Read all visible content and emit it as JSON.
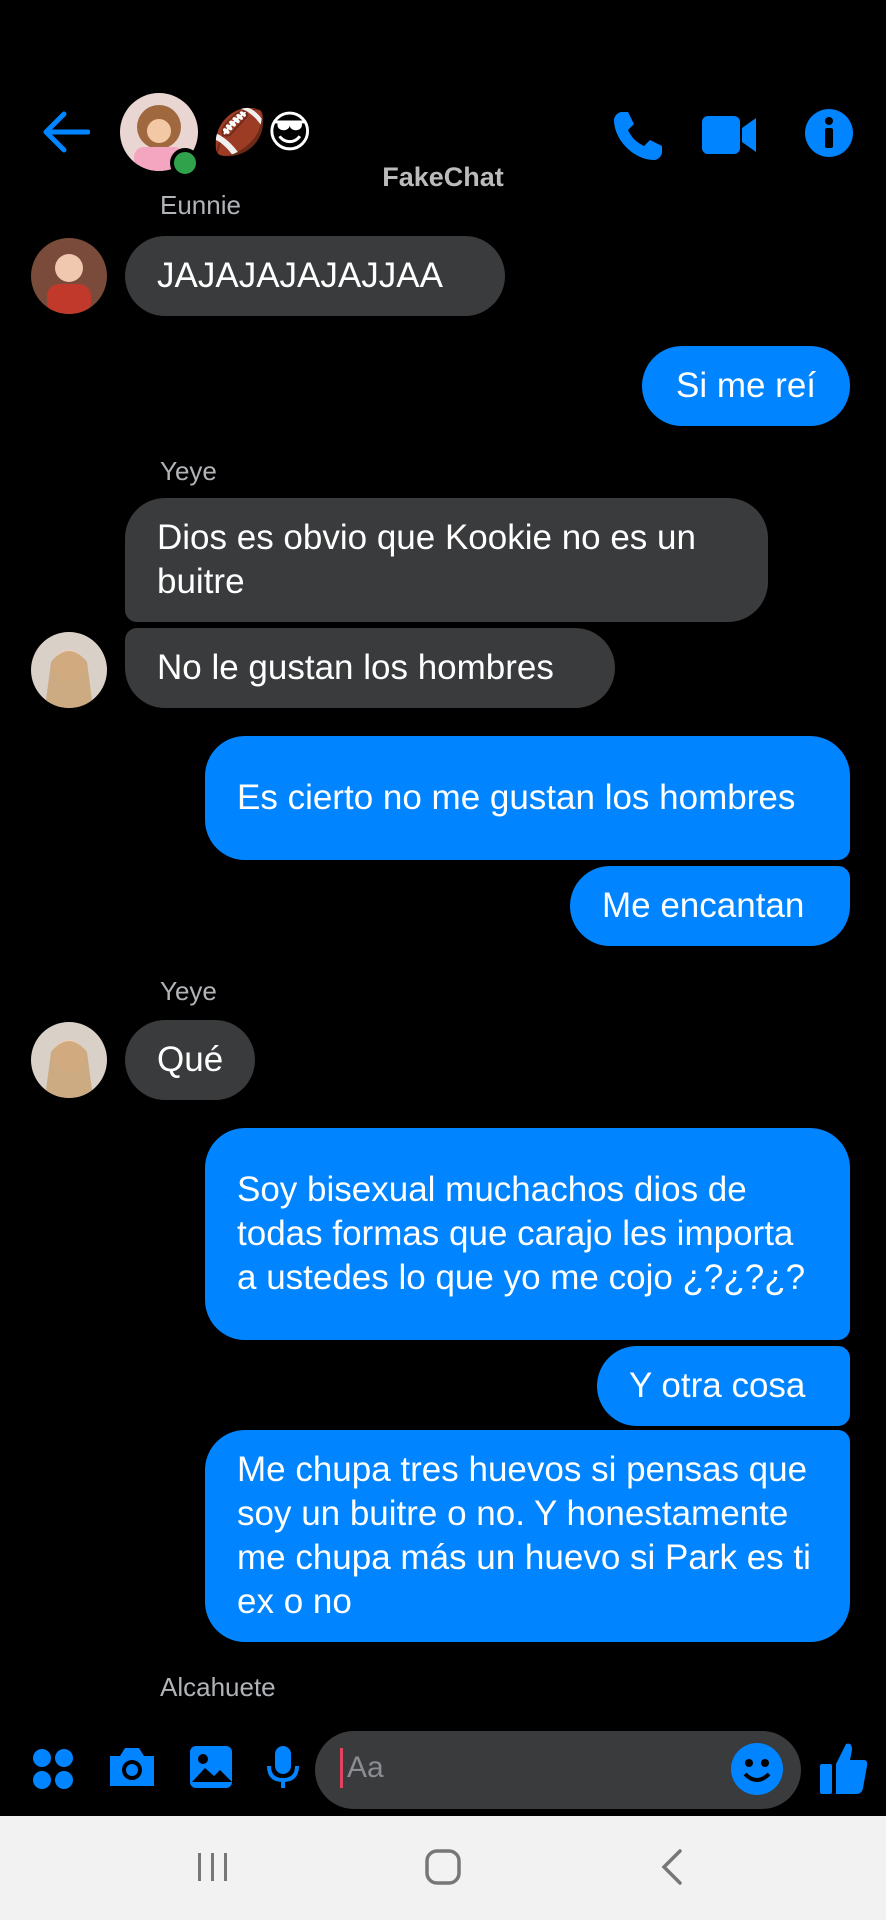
{
  "header": {
    "title": "FakeChat",
    "group_emojis": "🏈😎",
    "back_icon": "arrow-left-icon",
    "call_icon": "phone-icon",
    "video_icon": "video-camera-icon",
    "info_icon": "info-icon",
    "accent": "#0084ff"
  },
  "messages": {
    "m0_name": "Eunnie",
    "m0_text": "JAJAJAJAJAJJAA",
    "m1_text": "Si me reí",
    "m2_name": "Yeye",
    "m2_text": "Dios es obvio que Kookie no es un buitre",
    "m3_text": "No le gustan los hombres",
    "m4_text": "Es cierto no me gustan los hombres",
    "m5_text": "Me encantan",
    "m6_name": "Yeye",
    "m6_text": "Qué",
    "m7_text": "Soy bisexual muchachos dios de todas formas que carajo les importa a ustedes lo que yo me cojo ¿?¿?¿?",
    "m8_text": "Y otra cosa",
    "m9_text": "Me chupa tres huevos si pensas que soy un buitre o no. Y honestamente me chupa más un huevo si Park es ti ex o no",
    "m10_name": "Alcahuete"
  },
  "composer": {
    "placeholder": "Aa",
    "icons": [
      "apps-icon",
      "camera-icon",
      "image-icon",
      "microphone-icon",
      "emoji-icon",
      "thumbs-up-icon"
    ]
  },
  "navbar": {
    "icons": [
      "recent-apps-icon",
      "home-icon",
      "back-icon"
    ]
  }
}
